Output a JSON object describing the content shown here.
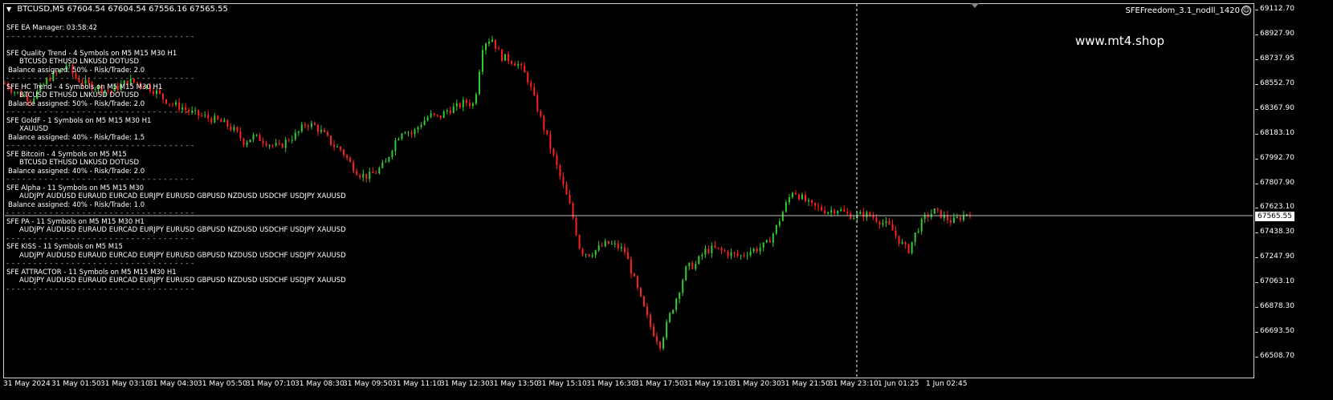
{
  "header": {
    "symbol": "BTCUSD,M5",
    "ohlc": "67604.54 67604.54 67556.16 67565.55"
  },
  "ea_name": "SFEFreedom_3.1_nodll_1420",
  "smile_icon": "smiley-icon",
  "website": "www.mt4.shop",
  "current_price": "67565.55",
  "separator": "- - - - - - - - - - - - - - - - - - - - - - - - - - - - - - - - - - -",
  "panel": {
    "manager": "SFE EA Manager: 03:58:42",
    "strategies": [
      {
        "title": "SFE Quality Trend - 4 Symbols on M5 M15 M30 H1",
        "symbols": "BTCUSD ETHUSD LNKUSD DOTUSD",
        "balance": "Balance assigned: 50% -  Risk/Trade: 2.0"
      },
      {
        "title": "SFE HC Trend - 4 Symbols on M5 M15 M30 H1",
        "symbols": "BTCUSD ETHUSD LNKUSD DOTUSD",
        "balance": "Balance assigned: 50% -  Risk/Trade: 2.0"
      },
      {
        "title": "SFE GoldF - 1 Symbols on M5 M15 M30 H1",
        "symbols": "XAUUSD",
        "balance": "Balance assigned: 40% -  Risk/Trade: 1.5"
      },
      {
        "title": "SFE Bitcoin - 4 Symbols on M5 M15",
        "symbols": "BTCUSD ETHUSD LNKUSD DOTUSD",
        "balance": "Balance assigned: 40% -  Risk/Trade: 2.0"
      },
      {
        "title": "SFE Alpha - 11 Symbols on M5 M15 M30",
        "symbols": "AUDJPY AUDUSD EURAUD EURCAD EURJPY EURUSD GBPUSD NZDUSD USDCHF USDJPY XAUUSD",
        "balance": "Balance assigned: 40% -  Risk/Trade: 1.0"
      },
      {
        "title": "SFE PA - 11 Symbols on M5 M15 M30 H1",
        "symbols": "AUDJPY AUDUSD EURAUD EURCAD EURJPY EURUSD GBPUSD NZDUSD USDCHF USDJPY XAUUSD",
        "balance": ""
      },
      {
        "title": "SFE KISS - 11 Symbols on M5 M15",
        "symbols": "AUDJPY AUDUSD EURAUD EURCAD EURJPY EURUSD GBPUSD NZDUSD USDCHF USDJPY XAUUSD",
        "balance": ""
      },
      {
        "title": "SFE ATTRACTOR - 11 Symbols on M5 M15 M30 H1",
        "symbols": "AUDJPY AUDUSD EURAUD EURCAD EURJPY EURUSD GBPUSD NZDUSD USDCHF USDJPY XAUUSD",
        "balance": ""
      }
    ]
  },
  "y_ticks": [
    "69112.70",
    "68927.90",
    "68737.95",
    "68552.70",
    "68367.90",
    "68183.10",
    "67992.70",
    "67807.90",
    "67623.10",
    "67438.30",
    "67247.90",
    "67063.10",
    "66878.30",
    "66693.50",
    "66508.70"
  ],
  "x_ticks": [
    "31 May 2024",
    "31 May 01:50",
    "31 May 03:10",
    "31 May 04:30",
    "31 May 05:50",
    "31 May 07:10",
    "31 May 08:30",
    "31 May 09:50",
    "31 May 11:10",
    "31 May 12:30",
    "31 May 13:50",
    "31 May 15:10",
    "31 May 16:30",
    "31 May 17:50",
    "31 May 19:10",
    "31 May 20:30",
    "31 May 21:50",
    "31 May 23:10",
    "1 Jun 01:25",
    "1 Jun 02:45"
  ],
  "colors": {
    "bull": "#32cd32",
    "bear": "#ff2020",
    "background": "#000000"
  },
  "chart_data": {
    "type": "candlestick",
    "symbol": "BTCUSD",
    "timeframe": "M5",
    "ylim": [
      66508.7,
      69112.7
    ],
    "close_path": [
      68560,
      68500,
      68470,
      68440,
      68520,
      68600,
      68640,
      68700,
      68600,
      68560,
      68540,
      68520,
      68500,
      68540,
      68580,
      68560,
      68540,
      68500,
      68440,
      68400,
      68380,
      68340,
      68320,
      68300,
      68280,
      68250,
      68200,
      68120,
      68160,
      68140,
      68100,
      68080,
      68140,
      68180,
      68260,
      68240,
      68180,
      68100,
      68060,
      67960,
      67880,
      67860,
      67900,
      67960,
      68120,
      68220,
      68180,
      68260,
      68320,
      68300,
      68360,
      68380,
      68420,
      68400,
      68860,
      68900,
      68760,
      68740,
      68700,
      68600,
      68400,
      68200,
      68000,
      67800,
      67600,
      67300,
      67280,
      67320,
      67360,
      67340,
      67300,
      67100,
      66900,
      66720,
      66600,
      66800,
      66980,
      67180,
      67200,
      67300,
      67320,
      67300,
      67280,
      67260,
      67300,
      67320,
      67350,
      67460,
      67620,
      67760,
      67700,
      67640,
      67620,
      67600,
      67620,
      67580,
      67560,
      67580,
      67560,
      67520,
      67480,
      67380,
      67300,
      67460,
      67560,
      67600,
      67560,
      67520,
      67560,
      67600
    ]
  }
}
